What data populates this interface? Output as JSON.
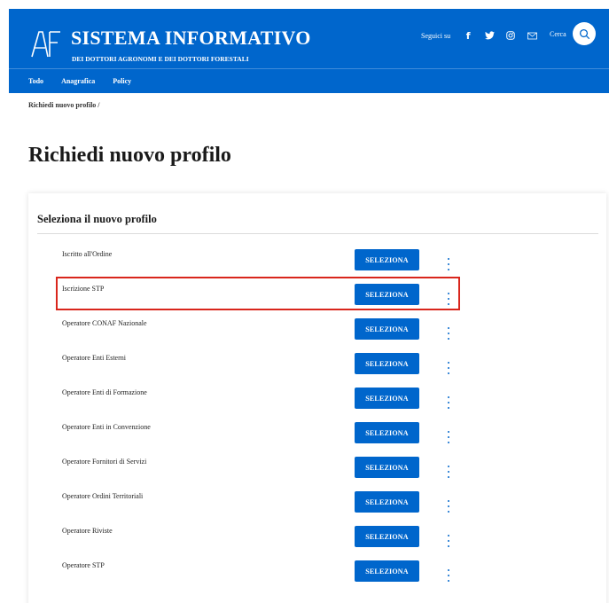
{
  "header": {
    "title": "SISTEMA INFORMATIVO",
    "subtitle": "DEI DOTTORI AGRONOMI E DEI DOTTORI FORESTALI",
    "social_label": "Seguici su",
    "social_icons": [
      "facebook-icon",
      "twitter-icon",
      "instagram-icon",
      "mail-icon"
    ],
    "search_label": "Cerca",
    "nav": [
      "Todo",
      "Anagrafica",
      "Policy"
    ],
    "brand_color": "#0066cc"
  },
  "breadcrumb": "Richiedi nuovo profilo  /",
  "page_title": "Richiedi nuovo profilo",
  "card": {
    "title": "Seleziona il nuovo profilo",
    "button_label": "SELEZIONA",
    "profiles": [
      "Iscritto all'Ordine",
      "Iscrizione STP",
      "Operatore CONAF Nazionale",
      "Operatore Enti Esterni",
      "Operatore Enti di Formazione",
      "Operatore Enti in Convenzione",
      "Operatore Fornitori di Servizi",
      "Operatore Ordini Territoriali",
      "Operatore Riviste",
      "Operatore STP"
    ],
    "highlighted_profile": "Iscrizione STP",
    "highlight_color": "#d9261c"
  }
}
